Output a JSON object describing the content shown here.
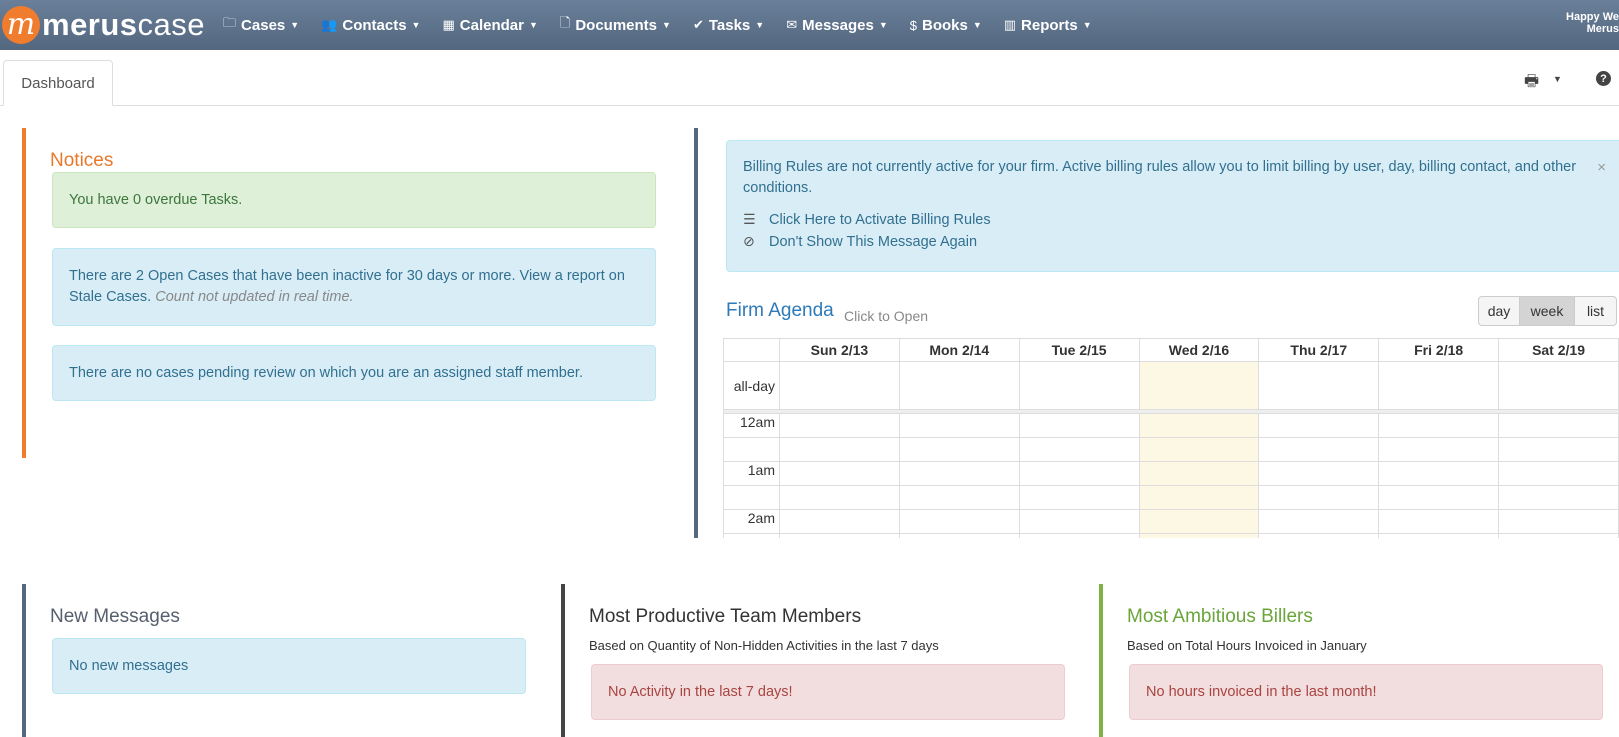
{
  "brand": {
    "logo_mark": "m",
    "name_bold": "merus",
    "name_light": "case"
  },
  "colors": {
    "nav": "#5b6f88",
    "accent_orange": "#f07c2e",
    "accent_green": "#7fb243",
    "info_bg": "#d9edf7",
    "success_bg": "#dff0d8",
    "danger_bg": "#f2dede"
  },
  "nav": {
    "items": [
      {
        "label": "Cases",
        "icon": "folder-icon"
      },
      {
        "label": "Contacts",
        "icon": "users-icon"
      },
      {
        "label": "Calendar",
        "icon": "calendar-icon"
      },
      {
        "label": "Documents",
        "icon": "document-icon"
      },
      {
        "label": "Tasks",
        "icon": "check-circle-icon"
      },
      {
        "label": "Messages",
        "icon": "envelope-icon"
      },
      {
        "label": "Books",
        "icon": "dollar-icon"
      },
      {
        "label": "Reports",
        "icon": "bar-chart-icon"
      }
    ],
    "user_line1": "Happy We",
    "user_line2": "Merus"
  },
  "tabs": {
    "dashboard": "Dashboard"
  },
  "notices": {
    "title": "Notices",
    "overdue": "You have 0 overdue Tasks.",
    "stale_main": "There are 2 Open Cases that have been inactive for 30 days or more. View a report on Stale Cases.",
    "stale_note": "Count not updated in real time.",
    "pending": "There are no cases pending review on which you are an assigned staff member."
  },
  "billing": {
    "message": "Billing Rules are not currently active for your firm. Active billing rules allow you to limit billing by user, day, billing contact, and other conditions.",
    "activate": "Click Here to Activate Billing Rules",
    "dismiss": "Don't Show This Message Again",
    "close": "×"
  },
  "agenda": {
    "title": "Firm Agenda",
    "subtitle": "Click to Open",
    "views": {
      "day": "day",
      "week": "week",
      "list": "list"
    },
    "days": [
      "Sun 2/13",
      "Mon 2/14",
      "Tue 2/15",
      "Wed 2/16",
      "Thu 2/17",
      "Fri 2/18",
      "Sat 2/19"
    ],
    "today_index": 3,
    "allday_label": "all-day",
    "times": [
      "12am",
      "1am",
      "2am"
    ]
  },
  "messages": {
    "title": "New Messages",
    "empty": "No new messages"
  },
  "productive": {
    "title": "Most Productive Team Members",
    "subtitle": "Based on Quantity of Non-Hidden Activities in the last 7 days",
    "empty": "No Activity in the last 7 days!"
  },
  "billers": {
    "title": "Most Ambitious Billers",
    "subtitle": "Based on Total Hours Invoiced in January",
    "empty": "No hours invoiced in the last month!"
  }
}
